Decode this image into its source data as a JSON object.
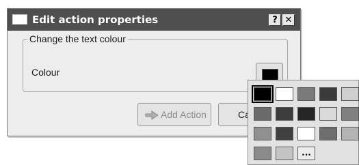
{
  "window": {
    "title": "Edit action properties",
    "help_label": "?",
    "close_label": "✕"
  },
  "group": {
    "legend": "Change the text colour",
    "colour_label": "Colour",
    "current_colour": "#000000"
  },
  "buttons": {
    "add_action": "Add Action",
    "cancel_visible": "Ca"
  },
  "palette": {
    "rows": [
      [
        "#000000",
        "#ffffff",
        "#7a7a7a",
        "#3a3a3a",
        "#cfcfcf"
      ],
      [
        "#6a6a6a",
        "#3c3c3c",
        "#262626",
        "#dadada",
        "#808080"
      ],
      [
        "#909090",
        "#404040",
        "#ffffff",
        "#6e6e6e",
        "#b4b4b4"
      ],
      [
        "#8a8a8a",
        "#c4c4c4"
      ]
    ],
    "more_label": "..."
  }
}
